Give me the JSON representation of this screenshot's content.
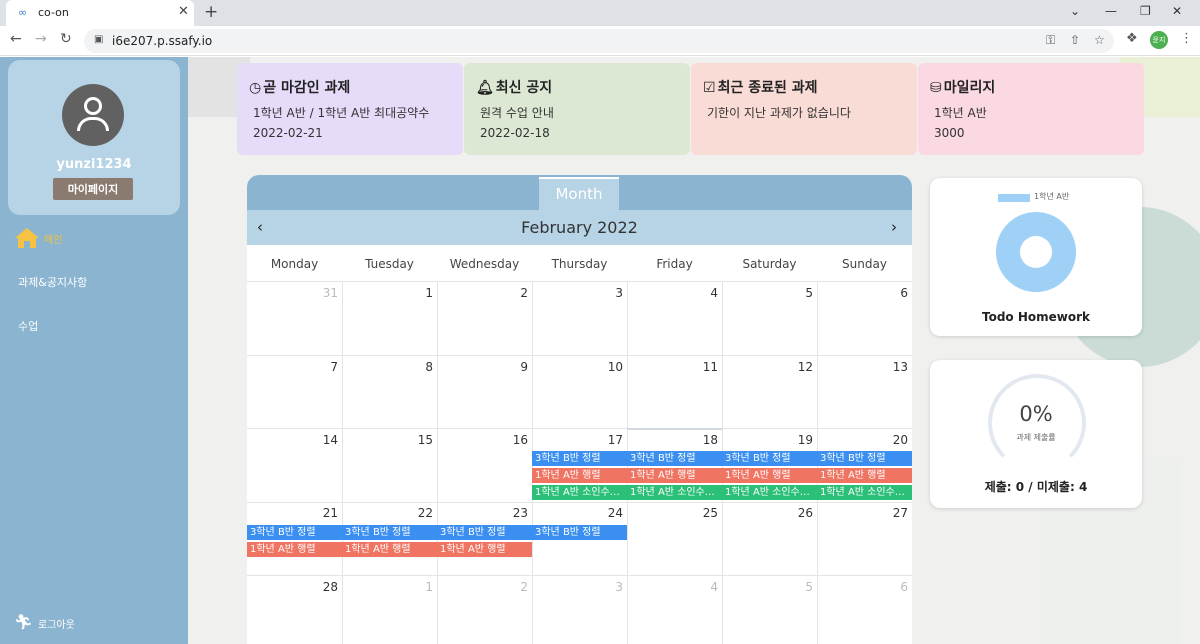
{
  "browser": {
    "tab_title": "co-on",
    "url": "i6e207.p.ssafy.io",
    "profile_initial": "윤지"
  },
  "sidebar": {
    "username": "yunzi1234",
    "mypage_label": "마이페이지",
    "menu": [
      {
        "label": "메인",
        "icon": "home-icon",
        "active": true
      },
      {
        "label": "과제&공지사항"
      },
      {
        "label": "수업"
      }
    ],
    "logout_label": "로그아웃"
  },
  "cards": [
    {
      "title": "곧 마감인 과제",
      "icon": "clock-icon",
      "line1": "1학년 A반 / 1학년 A반 최대공약수",
      "line2": "2022-02-21",
      "color": "#e6dbf8"
    },
    {
      "title": "최신 공지",
      "icon": "bell-icon",
      "line1": "원격 수업 안내",
      "line2": "2022-02-18",
      "color": "#dde8d4"
    },
    {
      "title": "최근 종료된 과제",
      "icon": "calendar-check-icon",
      "line1": "기한이 지난 과제가 없습니다",
      "line2": "",
      "color": "#f9dcd5"
    },
    {
      "title": "마일리지",
      "icon": "coins-icon",
      "line1": "1학년 A반",
      "line2": "3000",
      "color": "#fbd9e2"
    }
  ],
  "calendar": {
    "view_tab": "Month",
    "month_title": "February 2022",
    "weekdays": [
      "Monday",
      "Tuesday",
      "Wednesday",
      "Thursday",
      "Friday",
      "Saturday",
      "Sunday"
    ],
    "weeks": [
      [
        "31",
        "1",
        "2",
        "3",
        "4",
        "5",
        "6"
      ],
      [
        "7",
        "8",
        "9",
        "10",
        "11",
        "12",
        "13"
      ],
      [
        "14",
        "15",
        "16",
        "17",
        "18",
        "19",
        "20"
      ],
      [
        "21",
        "22",
        "23",
        "24",
        "25",
        "26",
        "27"
      ],
      [
        "28",
        "1",
        "2",
        "3",
        "4",
        "5",
        "6"
      ]
    ],
    "events": {
      "e1": "3학년 B반 정렬",
      "e2": "1학년 A반 행렬",
      "e3": "1학년 A반 소인수…"
    }
  },
  "chart_data": {
    "type": "pie",
    "categories": [
      "1학년 A반"
    ],
    "values": [
      1
    ],
    "title": "Todo Homework"
  },
  "submission": {
    "percent": "0%",
    "label": "과제 제출률",
    "stat": "제출: 0 / 미제출: 4"
  }
}
